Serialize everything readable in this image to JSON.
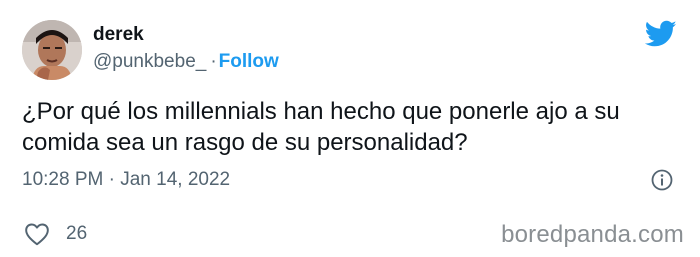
{
  "tweet": {
    "author_name": "derek",
    "handle": "@punkbebe_",
    "separator": "·",
    "follow_label": "Follow",
    "text": "¿Por qué los millennials han hecho que ponerle ajo a su comida sea un rasgo de su personalidad?",
    "timestamp": "10:28 PM · Jan 14, 2022",
    "like_count": "26"
  },
  "watermark": "boredpanda.com",
  "icons": {
    "brand": "twitter-bird-icon",
    "info": "info-icon",
    "like": "heart-icon"
  },
  "colors": {
    "accent": "#1d9bf0",
    "secondary_text": "#536471",
    "primary_text": "#0f1419"
  }
}
